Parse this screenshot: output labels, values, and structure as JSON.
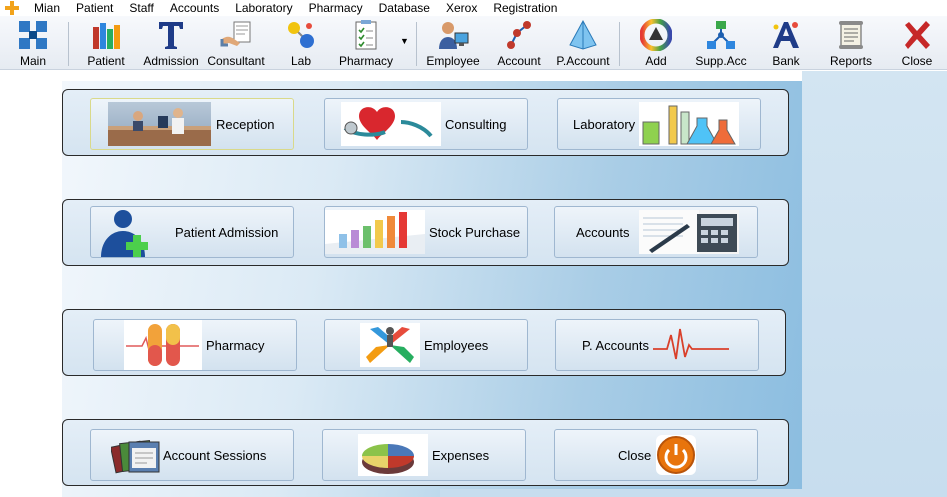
{
  "menubar": {
    "items": [
      "Mian",
      "Patient",
      "Staff",
      "Accounts",
      "Laboratory",
      "Pharmacy",
      "Database",
      "Xerox",
      "Registration"
    ]
  },
  "toolbar": {
    "main": "Main",
    "patient": "Patient",
    "admission": "Admission",
    "consultant": "Consultant",
    "lab": "Lab",
    "pharmacy": "Pharmacy",
    "employee": "Employee",
    "account": "Account",
    "paccount": "P.Account",
    "add": "Add",
    "suppacc": "Supp.Acc",
    "bank": "Bank",
    "reports": "Reports",
    "close": "Close"
  },
  "modules": {
    "reception": "Reception",
    "consulting": "Consulting",
    "laboratory": "Laboratory",
    "patient_admission": "Patient Admission",
    "stock_purchase": "Stock Purchase",
    "accounts": "Accounts",
    "pharmacy": "Pharmacy",
    "employees": "Employees",
    "p_accounts": "P. Accounts",
    "account_sessions": "Account Sessions",
    "expenses": "Expenses",
    "close": "Close"
  },
  "colors": {
    "accent": "#3a7fc4",
    "close_red": "#c62828",
    "orange": "#e8740c"
  }
}
